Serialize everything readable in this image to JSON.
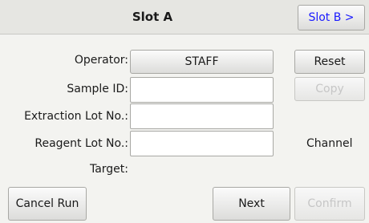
{
  "header": {
    "title": "Slot A",
    "slot_b_label": "Slot B >"
  },
  "form": {
    "operator_label": "Operator:",
    "operator_value": "STAFF",
    "sample_id_label": "Sample ID:",
    "sample_id_value": "",
    "extraction_lot_label": "Extraction Lot No.:",
    "extraction_lot_value": "",
    "reagent_lot_label": "Reagent Lot No.:",
    "reagent_lot_value": "",
    "target_label": "Target:"
  },
  "side": {
    "reset_label": "Reset",
    "copy_label": "Copy",
    "channel_label": "Channel"
  },
  "footer": {
    "cancel_label": "Cancel Run",
    "next_label": "Next",
    "confirm_label": "Confirm"
  },
  "colors": {
    "slot_b_text": "#1a1aff",
    "disabled_text": "#c6c6c6",
    "header_bg": "#e6e6e2",
    "screen_bg": "#f3f3f0"
  }
}
